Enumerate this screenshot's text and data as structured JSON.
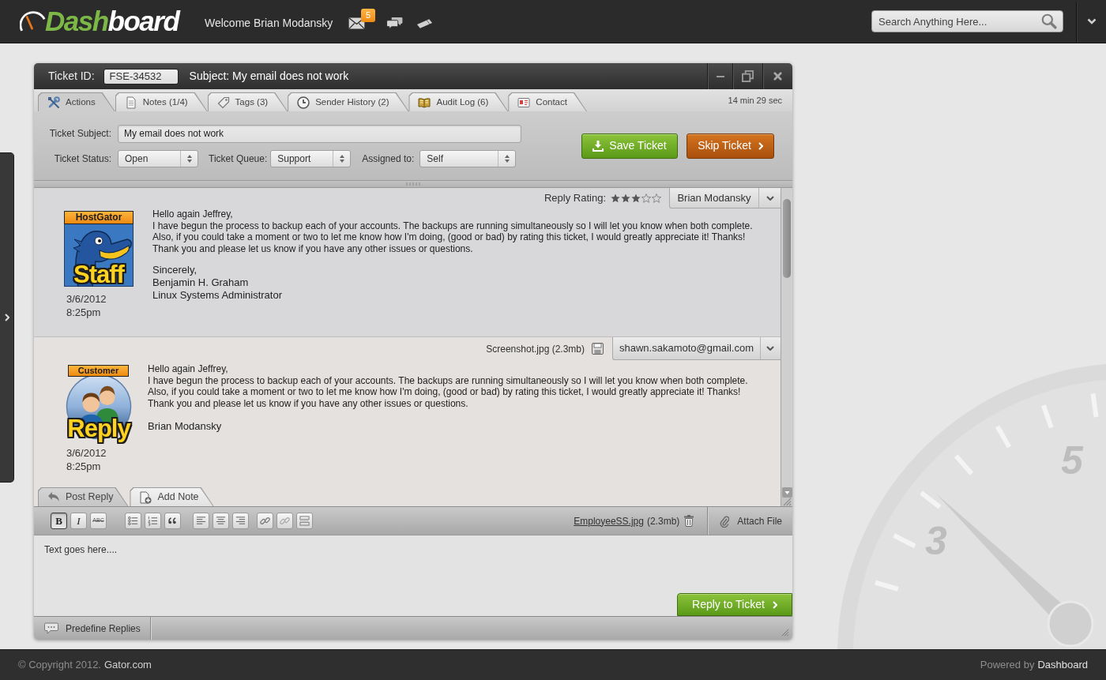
{
  "top_bar": {
    "logo": {
      "accent": "Dash",
      "rest": "board"
    },
    "welcome": "Welcome Brian Modansky",
    "icons": [
      {
        "kind": "mail",
        "badge": "5"
      },
      {
        "kind": "chat"
      },
      {
        "kind": "ticket"
      }
    ],
    "search": {
      "placeholder": "Search Anything Here..."
    }
  },
  "ticket": {
    "id_label": "Ticket ID:",
    "id_value": "FSE-34532",
    "subject": "Subject: My email does not work",
    "tabs": [
      {
        "kind": "tools",
        "label": "Actions",
        "selected": true
      },
      {
        "kind": "notes",
        "label": "Notes (1/4)",
        "selected": false
      },
      {
        "kind": "tags",
        "label": "Tags (3)",
        "selected": false
      },
      {
        "kind": "history",
        "label": "Sender History (2)",
        "selected": false
      },
      {
        "kind": "log",
        "label": "Audit Log (6)",
        "selected": false
      },
      {
        "kind": "contact",
        "label": "Contact",
        "selected": false
      }
    ],
    "timer": "14 min 29 sec",
    "form": {
      "subject_label": "Ticket Subject:",
      "subject_value": "My email does not work",
      "selects": [
        {
          "label": "Ticket Status:",
          "value": "Open"
        },
        {
          "label": "Ticket Queue:",
          "value": "Support"
        },
        {
          "label": "Assigned to:",
          "value": "Self"
        }
      ]
    },
    "buttons": [
      {
        "kind": "save",
        "label": "Save Ticket"
      },
      {
        "kind": "skip",
        "label": "Skip Ticket"
      }
    ]
  },
  "messages": [
    {
      "kind": "staff",
      "badge": {
        "top": "HostGator",
        "bottom": "Staff"
      },
      "date": "3/6/2012",
      "time": "8:25pm",
      "rating_label": "Reply Rating:",
      "stars": 3,
      "author": "Brian Modansky",
      "lines": [
        "Hello again Jeffrey,",
        "I have begun the process to backup each of your accounts. The backups are running simultaneously so I will let you know when both complete.",
        "Also, if you could take a moment or two to let me know how I'm doing, (good or bad) by rating this ticket, I would greatly appreciate it! Thanks!",
        "Thank you and please let us know if you have any other issues or questions."
      ],
      "signature": [
        "Sincerely,",
        "Benjamin H. Graham",
        "Linux Systems Administrator"
      ]
    },
    {
      "kind": "customer",
      "badge": {
        "top": "Customer",
        "bottom": "Reply"
      },
      "date": "3/6/2012",
      "time": "8:25pm",
      "attachment": "Screenshot.jpg (2.3mb)",
      "author": "shawn.sakamoto@gmail.com",
      "lines": [
        "Hello again Jeffrey,",
        "I have begun the process to backup each of your accounts. The backups are running simultaneously so I will let you know when both complete.",
        "Also, if you could take a moment or two to let me know how I'm doing, (good or bad) by rating this ticket, I would greatly appreciate it! Thanks!",
        "Thank you and please let us know if you have any other issues or questions."
      ],
      "signature": [
        "Brian Modansky"
      ]
    }
  ],
  "reply": {
    "tabs": [
      {
        "kind": "reply",
        "label": "Post Reply",
        "selected": true
      },
      {
        "kind": "note",
        "label": "Add Note",
        "selected": false
      }
    ],
    "toolbar": [
      [
        {
          "kind": "bold",
          "label": "B",
          "pressed": true
        },
        {
          "kind": "italic",
          "label": "I",
          "pressed": false
        },
        {
          "kind": "strike",
          "label": "ABC",
          "pressed": false
        }
      ],
      [
        {
          "kind": "bullets",
          "pressed": false
        },
        {
          "kind": "numbers",
          "pressed": false
        },
        {
          "kind": "quote",
          "pressed": false
        }
      ],
      [
        {
          "kind": "align-left",
          "pressed": false
        },
        {
          "kind": "align-center",
          "pressed": false
        },
        {
          "kind": "align-right",
          "pressed": false
        }
      ],
      [
        {
          "kind": "link",
          "pressed": false
        },
        {
          "kind": "unlink",
          "pressed": false
        },
        {
          "kind": "rule",
          "pressed": false
        }
      ]
    ],
    "attachment": {
      "name": "EmployeeSS.jpg",
      "size": "(2.3mb)"
    },
    "attach_label": "Attach File",
    "placeholder": "Text goes here....",
    "submit": "Reply to Ticket",
    "predefined": "Predefine Replies"
  },
  "background": {
    "gauge_numbers": [
      "3",
      "5"
    ]
  },
  "footer": {
    "copyright": "© Copyright 2012.",
    "site": "Gator.com",
    "powered": "Powered by",
    "brand": "Dashboard"
  }
}
